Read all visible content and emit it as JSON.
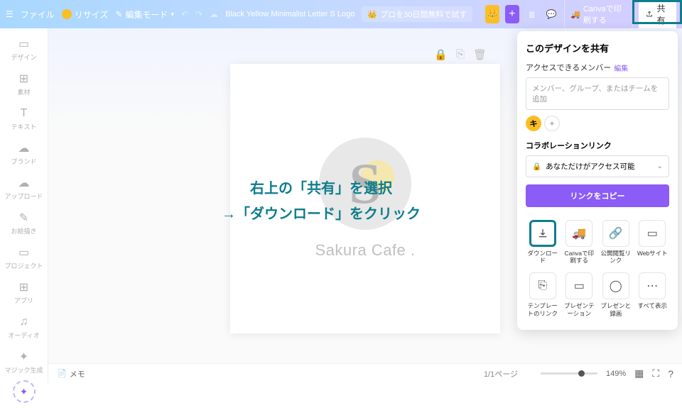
{
  "topbar": {
    "file": "ファイル",
    "resize": "リサイズ",
    "editMode": "編集モード",
    "docTitle": "Black Yellow Minimalist Letter S Logo",
    "trial": "プロを30日間無料で試す",
    "print": "Canvaで印刷する",
    "share": "共有"
  },
  "sidebar": {
    "items": [
      {
        "label": "デザイン"
      },
      {
        "label": "素材"
      },
      {
        "label": "テキスト"
      },
      {
        "label": "ブランド"
      },
      {
        "label": "アップロード"
      },
      {
        "label": "お絵描き"
      },
      {
        "label": "プロジェクト"
      },
      {
        "label": "アプリ"
      },
      {
        "label": "オーディオ"
      },
      {
        "label": "マジック生成"
      }
    ]
  },
  "canvas": {
    "logoText": "Sakura Cafe ."
  },
  "overlay": {
    "line1": "右上の「共有」を選択",
    "line2": "→「ダウンロード」をクリック"
  },
  "sharePanel": {
    "title": "このデザインを共有",
    "accessLabel": "アクセスできるメンバー",
    "editLink": "編集",
    "inputPlaceholder": "メンバー、グループ、またはチームを追加",
    "avatarLetter": "キ",
    "collabLabel": "コラボレーションリンク",
    "selectText": "あなただけがアクセス可能",
    "copyBtn": "リンクをコピー",
    "actions": [
      {
        "label": "ダウンロード"
      },
      {
        "label": "Canvaで印刷する"
      },
      {
        "label": "公開閲覧リンク"
      },
      {
        "label": "Webサイト"
      },
      {
        "label": "テンプレートのリンク"
      },
      {
        "label": "プレゼンテーション"
      },
      {
        "label": "プレゼンと録画"
      },
      {
        "label": "すべて表示"
      }
    ]
  },
  "bottombar": {
    "memo": "メモ",
    "pageInd": "1/1ページ",
    "zoom": "149%"
  }
}
